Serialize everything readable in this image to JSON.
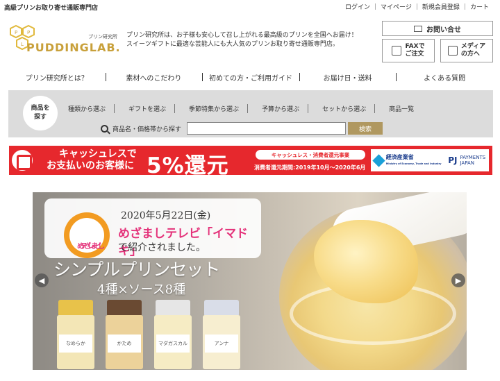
{
  "top": {
    "tagline": "高級プリンお取り寄せ通販専門店",
    "links": [
      "ログイン",
      "マイページ",
      "新規会員登録",
      "カート"
    ]
  },
  "logo": {
    "sub": "プリン研究所",
    "name": "PUDDINGLAB."
  },
  "intro": [
    "プリン研究所は、お子様も安心して召し上がれる最高級のプリンを全国へお届け！",
    "スイーツギフトに最適な芸能人にも大人気のプリンお取り寄せ通販専門店。"
  ],
  "buttons": {
    "contact": "お問い合せ",
    "fax": [
      "FAXで",
      "ご注文"
    ],
    "media": [
      "メディア",
      "の方へ"
    ]
  },
  "mainnav": [
    "プリン研究所とは？",
    "素材へのこだわり",
    "初めての方・ご利用ガイド",
    "お届け日・送料",
    "よくある質問"
  ],
  "search": {
    "badge": [
      "商品を",
      "探す"
    ],
    "subnav": [
      "種類から選ぶ",
      "ギフトを選ぶ",
      "季節特集から選ぶ",
      "予算から選ぶ",
      "セットから選ぶ",
      "商品一覧"
    ],
    "label": "商品名・価格帯から探す",
    "input_value": "",
    "button": "検索"
  },
  "cashless": {
    "line1": "キャッシュレスで",
    "line2": "お支払いのお客様に",
    "percent": "5%還元",
    "pill": "キャッシュレス・消費者還元事業",
    "period": "消費者還元期間:2019年10月〜2020年6月",
    "meti": [
      "経済産業省",
      "Ministry of Economy, Trade and Industry"
    ],
    "payments": [
      "PAYMENTS",
      "JAPAN"
    ]
  },
  "hero": {
    "date": "2020年5月22日(金)",
    "logo_text": [
      "めざまし",
      "テレビ"
    ],
    "tv": "めざましテレビ「イマドキ」",
    "introduced": "で紹介されました。",
    "title": "シンプルプリンセット",
    "subtitle": "4種×ソース8種",
    "bottles": [
      {
        "label": "なめらか",
        "lid": "#e8c24a"
      },
      {
        "label": "かため",
        "lid": "#6a4a32"
      },
      {
        "label": "マダガスカル",
        "lid": "#e6e6e6"
      },
      {
        "label": "アンナ",
        "lid": "#d9dde8"
      }
    ]
  },
  "colors": {
    "accent_red": "#e6282d",
    "gold": "#b09860"
  }
}
